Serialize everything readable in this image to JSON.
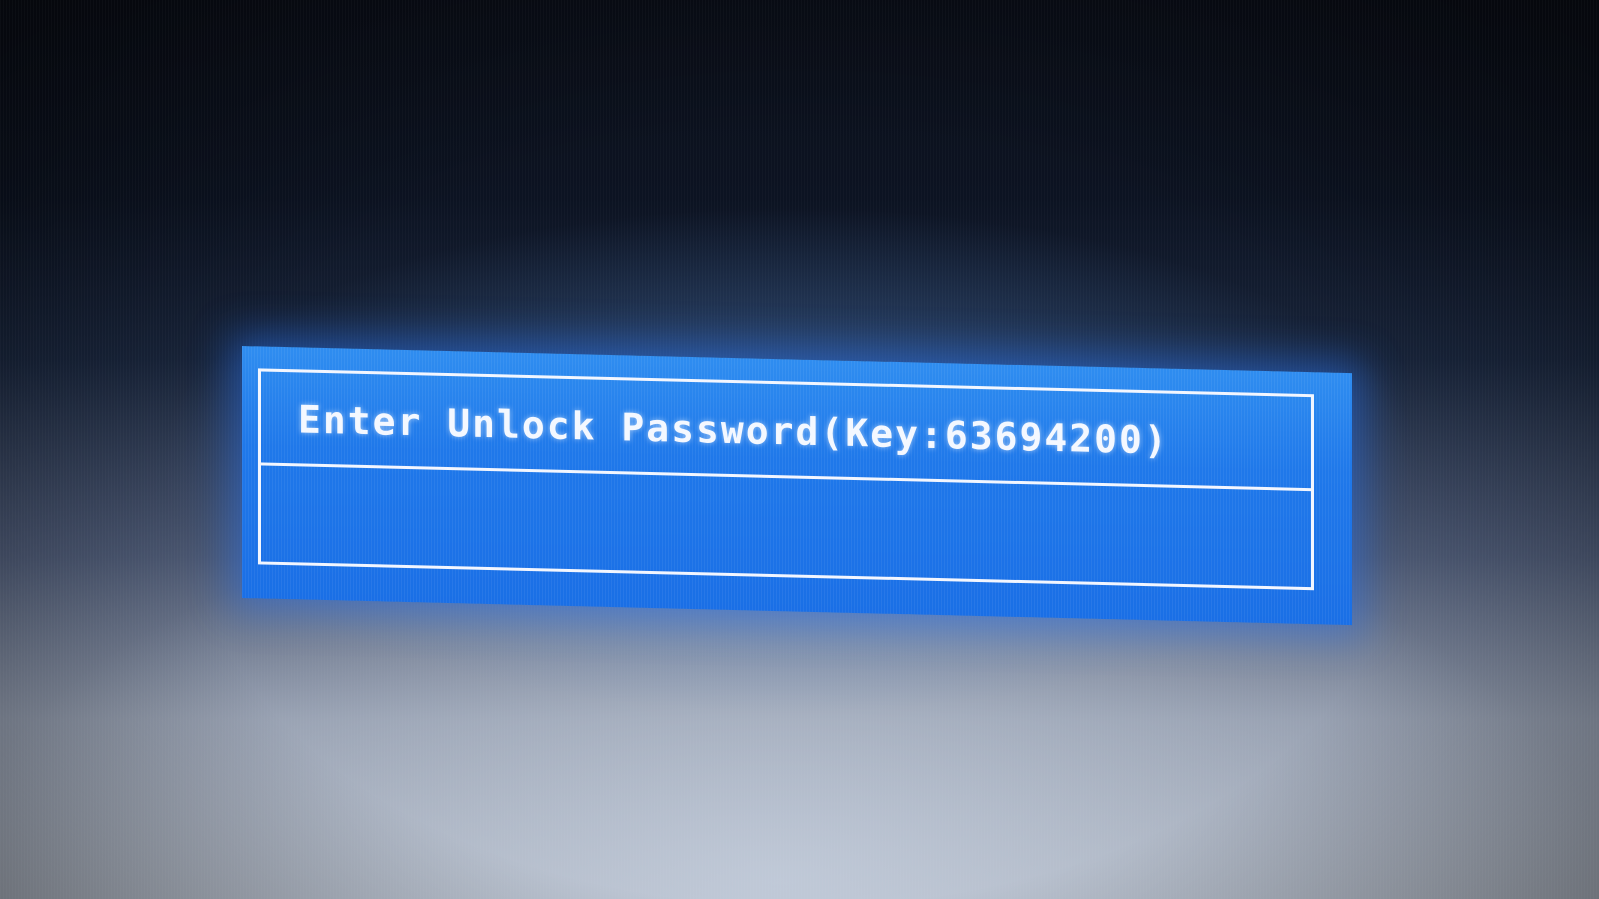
{
  "dialog": {
    "prompt": "Enter Unlock Password(Key:63694200)",
    "input_value": ""
  },
  "colors": {
    "dialog_blue": "#1f78ea",
    "frame_white": "#f2f6ff"
  }
}
